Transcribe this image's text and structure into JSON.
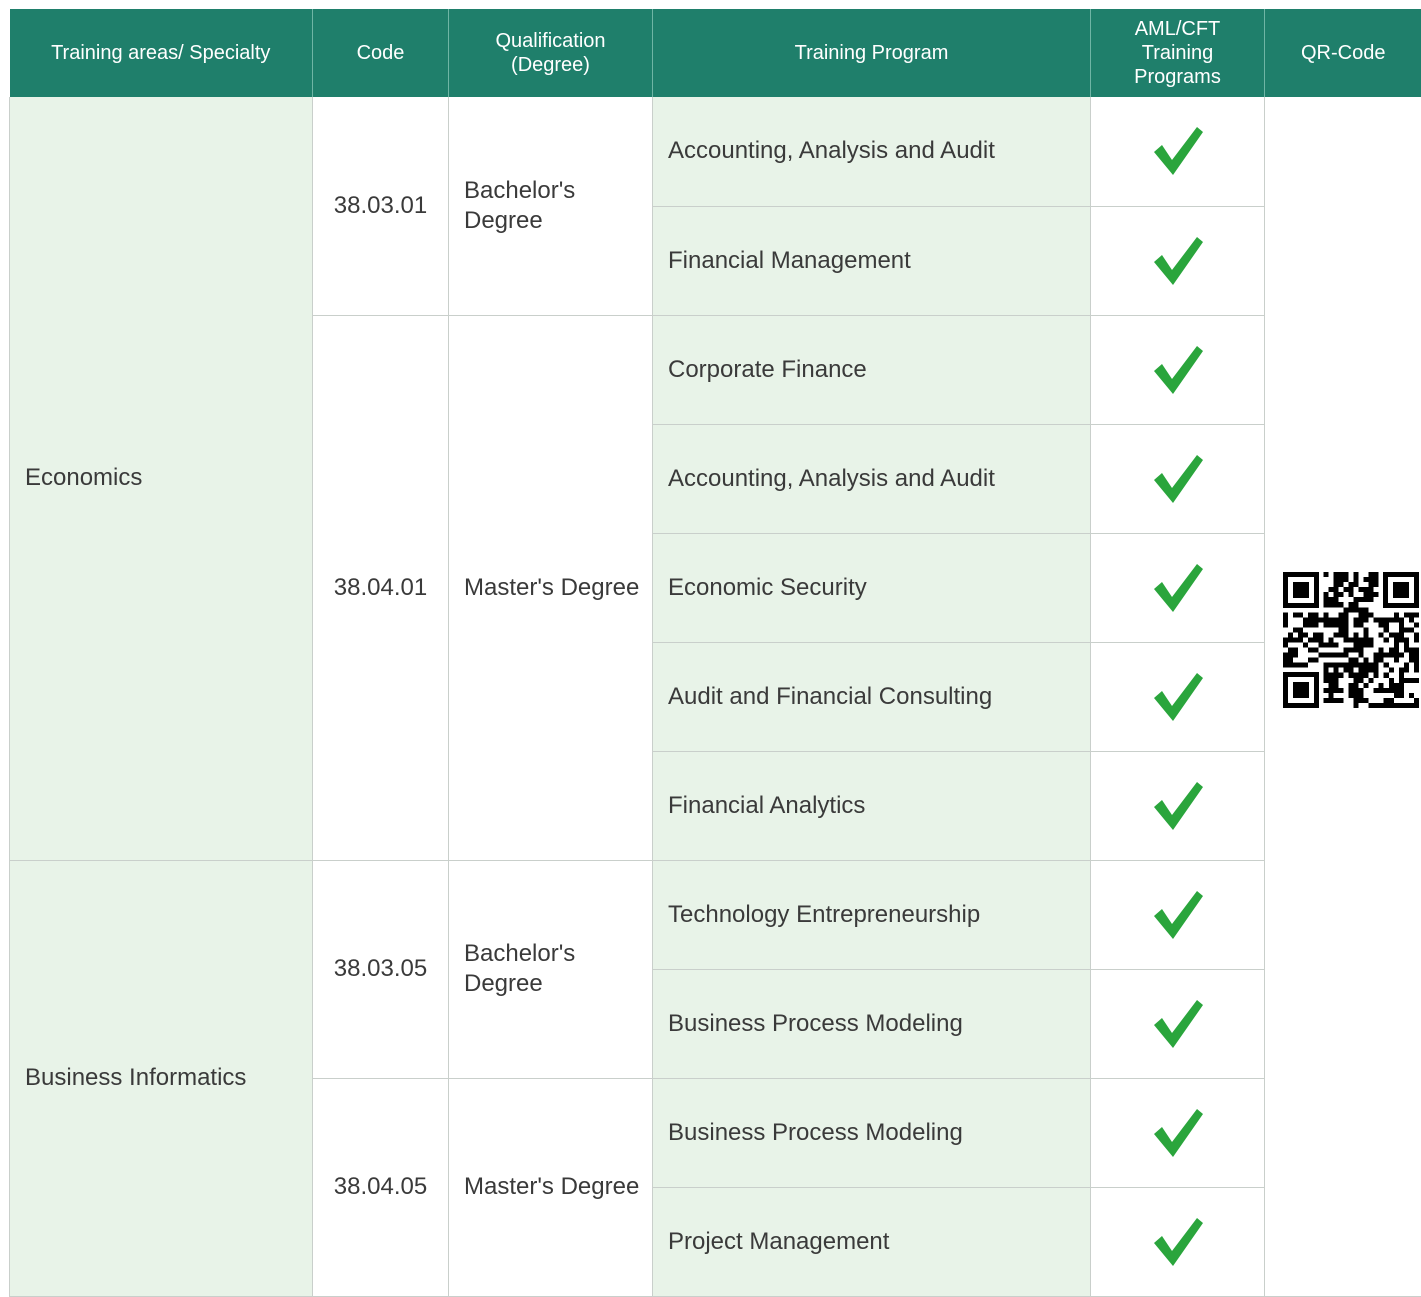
{
  "headers": {
    "area": "Training areas/ Specialty",
    "code": "Code",
    "qualification": "Qualification (Degree)",
    "program": "Training Program",
    "aml": "AML/CFT Training Programs",
    "qr": "QR-Code"
  },
  "rows": {
    "economics": {
      "area": "Economics",
      "bachelor": {
        "code": "38.03.01",
        "qualification": "Bachelor's Degree",
        "programs": [
          "Accounting, Analysis and Audit",
          "Financial Management"
        ]
      },
      "master": {
        "code": "38.04.01",
        "qualification": "Master's Degree",
        "programs": [
          "Corporate Finance",
          "Accounting, Analysis and Audit",
          "Economic Security",
          "Audit and Financial Consulting",
          "Financial Analytics"
        ]
      }
    },
    "business_informatics": {
      "area": "Business Informatics",
      "bachelor": {
        "code": "38.03.05",
        "qualification": "Bachelor's Degree",
        "programs": [
          "Technology Entrepreneurship",
          "Business Process Modeling"
        ]
      },
      "master": {
        "code": "38.04.05",
        "qualification": "Master's Degree",
        "programs": [
          "Business Process Modeling",
          "Project Management"
        ]
      }
    }
  },
  "aml_marked": [
    true,
    true,
    true,
    true,
    true,
    true,
    true,
    true,
    true,
    true,
    true
  ],
  "icons": {
    "aml": "checkmark-icon",
    "qr": "qr-code-image"
  },
  "colors": {
    "header": "#1f7f6b",
    "program_bg": "#e8f3e8",
    "check": "#2aa53c"
  }
}
